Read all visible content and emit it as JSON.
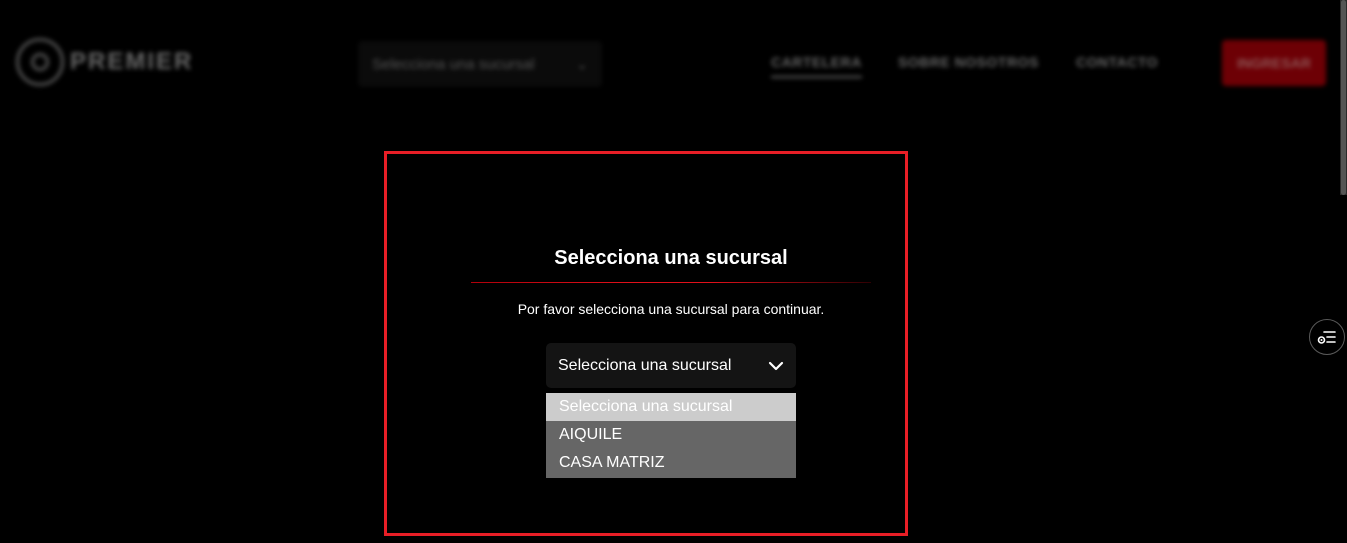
{
  "header": {
    "logo_text": "PREMIER",
    "branch_select": {
      "value": "Selecciona una sucursal"
    },
    "nav": [
      {
        "label": "CARTELERA"
      },
      {
        "label": "SOBRE NOSOTROS"
      },
      {
        "label": "CONTACTO"
      }
    ],
    "login_label": "INGRESAR"
  },
  "modal": {
    "title": "Selecciona una sucursal",
    "subtitle": "Por favor selecciona una sucursal para continuar.",
    "select": {
      "value": "Selecciona una sucursal",
      "options": [
        {
          "label": "Selecciona una sucursal",
          "selected": true
        },
        {
          "label": "AIQUILE",
          "selected": false
        },
        {
          "label": "CASA MATRIZ",
          "selected": false
        }
      ]
    }
  },
  "colors": {
    "accent": "#e81e26",
    "login_button": "#c7000a",
    "dropdown_bg": "#666666",
    "dropdown_selected_bg": "#cccccc"
  },
  "icons": {
    "select_chevron": "chevron-down-icon",
    "side_button": "filter-settings-icon"
  }
}
